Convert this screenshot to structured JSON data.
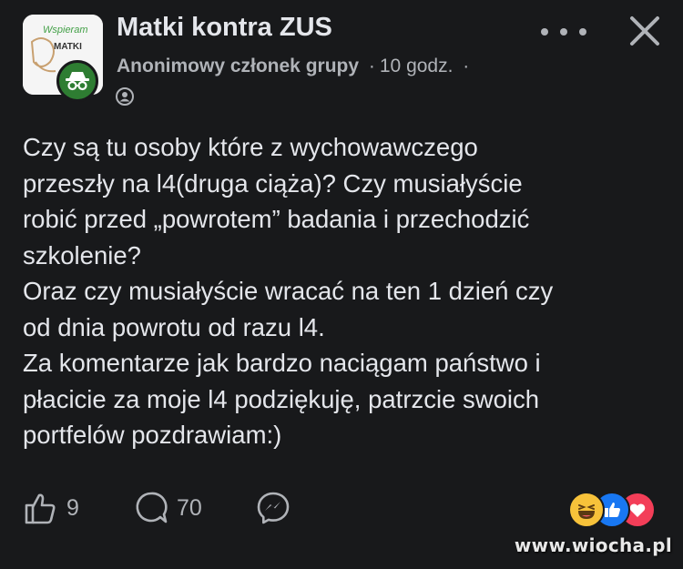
{
  "header": {
    "group_name": "Matki kontra ZUS",
    "author": "Anonimowy członek grupy",
    "time": "10 godz.",
    "separator": "·",
    "avatar_label": "Wspieram"
  },
  "post": {
    "lines": [
      "Czy są tu osoby które z wychowawczego",
      "przeszły na l4(druga ciąża)? Czy musiałyście",
      "robić przed „powrotem” badania i przechodzić",
      "szkolenie?",
      "Oraz czy musiałyście wracać na ten 1 dzień czy",
      "od dnia powrotu od razu l4.",
      "Za komentarze jak bardzo naciągam państwo i",
      "płacicie za moje l4 podziękuję, patrzcie swoich",
      "portfelów pozdrawiam:)"
    ]
  },
  "actions": {
    "likes": "9",
    "comments": "70"
  },
  "reactions": [
    "haha",
    "like",
    "love"
  ],
  "watermark": "www.wiocha.pl",
  "colors": {
    "background": "#18191b",
    "text": "#e4e6eb",
    "secondary": "#b0b3b8",
    "like": "#1877f2",
    "love": "#f33e58",
    "haha": "#f7c23a",
    "anon_badge": "#2e7d32"
  }
}
